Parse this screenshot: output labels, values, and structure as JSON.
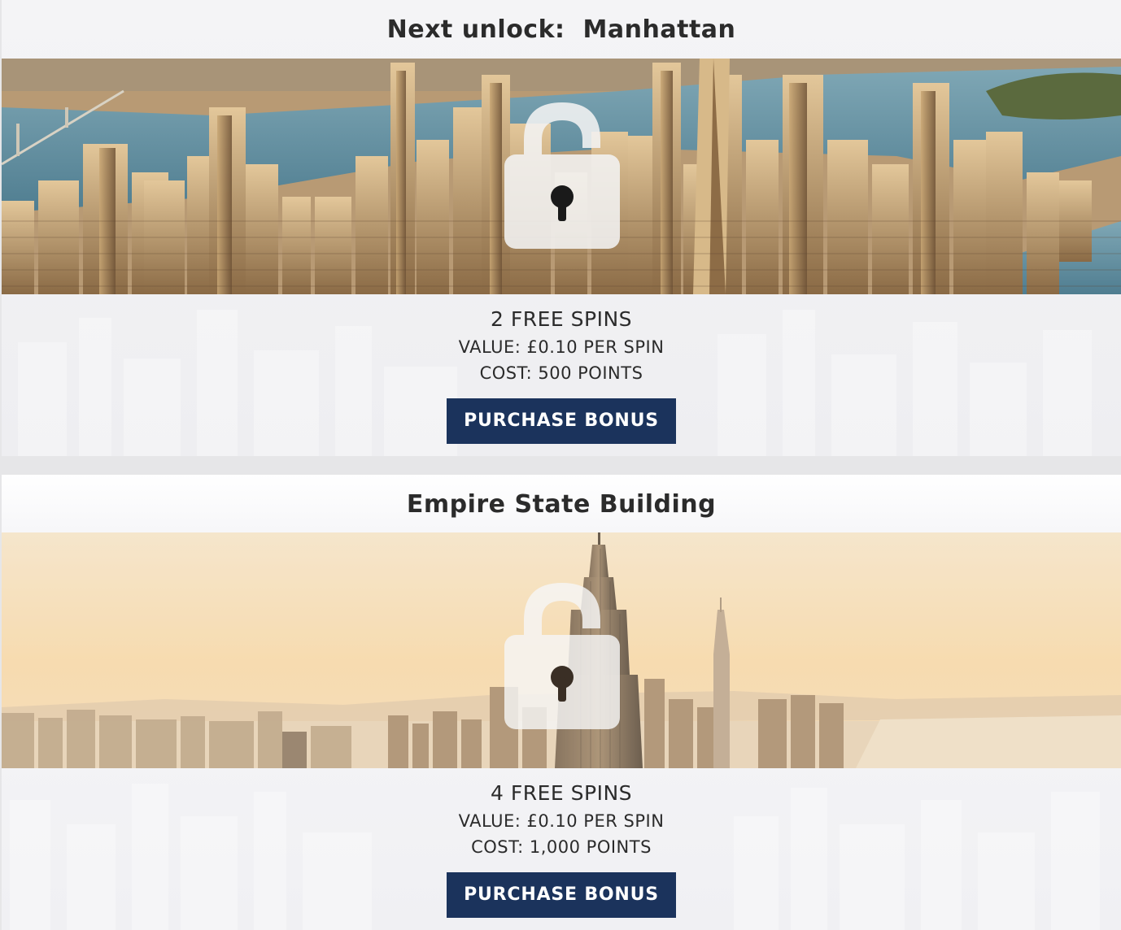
{
  "cards": [
    {
      "title_prefix": "Next unlock:",
      "title": "Manhattan",
      "spins": "2 FREE SPINS",
      "value": "VALUE: £0.10 PER SPIN",
      "cost": "COST: 500 POINTS",
      "button_label": "PURCHASE BONUS",
      "image_subject": "manhattan-skyline-aerial",
      "locked": true
    },
    {
      "title_prefix": "",
      "title": "Empire State Building",
      "spins": "4 FREE SPINS",
      "value": "VALUE: £0.10 PER SPIN",
      "cost": "COST: 1,000 POINTS",
      "button_label": "PURCHASE BONUS",
      "image_subject": "empire-state-building-skyline",
      "locked": true
    }
  ],
  "colors": {
    "button_bg": "#1b335c",
    "button_text": "#ffffff",
    "text": "#2b2b2b",
    "page_bg": "#e6e6e8"
  },
  "icons": {
    "lock": "padlock-icon"
  }
}
